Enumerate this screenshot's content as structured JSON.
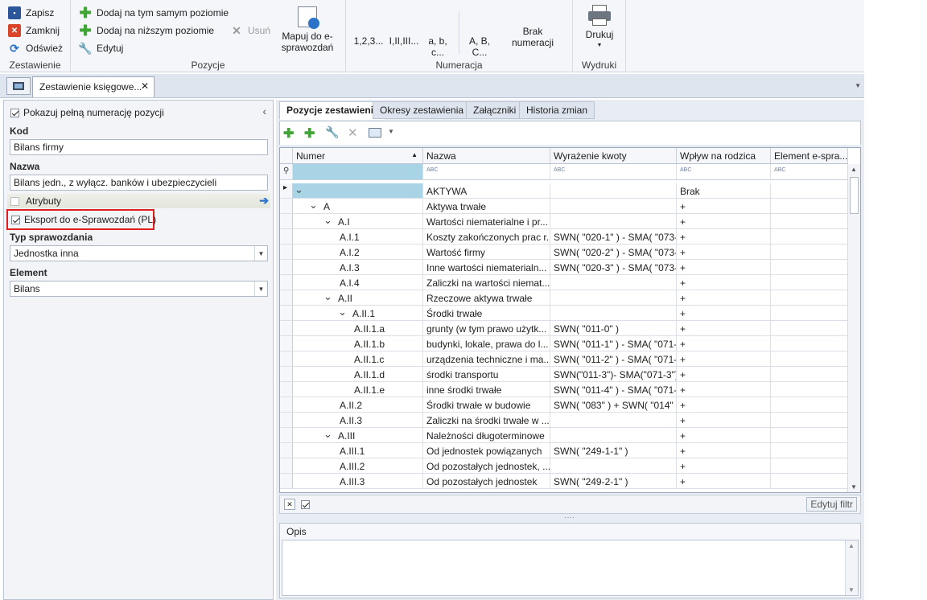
{
  "ribbon": {
    "zestawienie": {
      "save": "Zapisz",
      "close": "Zamknij",
      "refresh": "Odśwież",
      "label": "Zestawienie"
    },
    "pozycje": {
      "add_same": "Dodaj na tym samym poziomie",
      "add_lower": "Dodaj na niższym poziomie",
      "edit": "Edytuj",
      "delete": "Usuń",
      "map": "Mapuj do e-sprawozdań",
      "label": "Pozycje"
    },
    "numeracja": {
      "n1": "1,2,3...",
      "n2": "I,II,III...",
      "n3": "a, b, c...",
      "n4": "A, B, C...",
      "none": "Brak numeracji",
      "label": "Numeracja"
    },
    "wydruki": {
      "print": "Drukuj",
      "label": "Wydruki"
    }
  },
  "doc_tab": {
    "title": "Zestawienie księgowe..."
  },
  "left": {
    "show_full_numbering": "Pokazuj pełną numerację pozycji",
    "kod_label": "Kod",
    "kod_value": "Bilans firmy",
    "nazwa_label": "Nazwa",
    "nazwa_value": "Bilans jedn., z wyłącz. banków i ubezpieczycieli",
    "atrybuty": "Atrybuty",
    "export": "Eksport do e-Sprawozdań (PL)",
    "typ_label": "Typ sprawozdania",
    "typ_value": "Jednostka inna",
    "element_label": "Element",
    "element_value": "Bilans"
  },
  "tabs": [
    "Pozycje zestawienia",
    "Okresy zestawienia",
    "Załączniki",
    "Historia zmian"
  ],
  "grid": {
    "headers": [
      "Numer",
      "Nazwa",
      "Wyrażenie kwoty",
      "Wpływ na rodzica",
      "Element e-spra..."
    ],
    "filter_icon": "ABC",
    "rows": [
      {
        "num": "",
        "name": "AKTYWA",
        "expr": "",
        "impact": "Brak",
        "level": 0
      },
      {
        "num": "A",
        "name": "Aktywa trwałe",
        "expr": "",
        "impact": "+",
        "level": 1
      },
      {
        "num": "A.I",
        "name": "Wartości niematerialne i pr...",
        "expr": "",
        "impact": "+",
        "level": 2
      },
      {
        "num": "A.I.1",
        "name": "Koszty zakończonych prac r...",
        "expr": "SWN( \"020-1\" ) - SMA( \"073-...",
        "impact": "+",
        "level": 3
      },
      {
        "num": "A.I.2",
        "name": "Wartość firmy",
        "expr": "SWN( \"020-2\" ) - SMA( \"073-...",
        "impact": "+",
        "level": 3
      },
      {
        "num": "A.I.3",
        "name": "Inne wartości niematerialn...",
        "expr": "SWN( \"020-3\" ) - SMA( \"073-...",
        "impact": "+",
        "level": 3
      },
      {
        "num": "A.I.4",
        "name": "Zaliczki na wartości niemat...",
        "expr": "",
        "impact": "+",
        "level": 3
      },
      {
        "num": "A.II",
        "name": "Rzeczowe aktywa trwałe",
        "expr": "",
        "impact": "+",
        "level": 2
      },
      {
        "num": "A.II.1",
        "name": "Środki trwałe",
        "expr": "",
        "impact": "+",
        "level": 3
      },
      {
        "num": "A.II.1.a",
        "name": "grunty (w tym prawo użytk...",
        "expr": "SWN( \"011-0\" )",
        "impact": "+",
        "level": 4
      },
      {
        "num": "A.II.1.b",
        "name": "budynki, lokale, prawa do l...",
        "expr": "SWN( \"011-1\" ) - SMA( \"071-...",
        "impact": "+",
        "level": 4
      },
      {
        "num": "A.II.1.c",
        "name": "urządzenia techniczne i ma...",
        "expr": "SWN( \"011-2\" ) - SMA( \"071-...",
        "impact": "+",
        "level": 4
      },
      {
        "num": "A.II.1.d",
        "name": "środki transportu",
        "expr": "SWN(\"011-3\")- SMA(\"071-3\")...",
        "impact": "+",
        "level": 4
      },
      {
        "num": "A.II.1.e",
        "name": "inne środki trwałe",
        "expr": "SWN( \"011-4\" ) - SMA( \"071-...",
        "impact": "+",
        "level": 4
      },
      {
        "num": "A.II.2",
        "name": "Środki trwałe w budowie",
        "expr": "SWN( \"083\" ) + SWN( \"014\" )...",
        "impact": "+",
        "level": 3
      },
      {
        "num": "A.II.3",
        "name": "Zaliczki na środki trwałe w ...",
        "expr": "",
        "impact": "+",
        "level": 3
      },
      {
        "num": "A.III",
        "name": "Należności długoterminowe",
        "expr": "",
        "impact": "+",
        "level": 2
      },
      {
        "num": "A.III.1",
        "name": "Od jednostek powiązanych",
        "expr": "SWN( \"249-1-1\" )",
        "impact": "+",
        "level": 3
      },
      {
        "num": "A.III.2",
        "name": "Od pozostałych jednostek, ...",
        "expr": "",
        "impact": "+",
        "level": 3
      },
      {
        "num": "A.III.3",
        "name": "Od pozostałych jednostek",
        "expr": "SWN( \"249-2-1\" )",
        "impact": "+",
        "level": 3
      }
    ],
    "edit_filter": "Edytuj filtr"
  },
  "opis": {
    "label": "Opis"
  },
  "colors": {
    "accent": "#2b579a",
    "highlight": "#e02020",
    "selected_cell": "#a8d4e6"
  }
}
